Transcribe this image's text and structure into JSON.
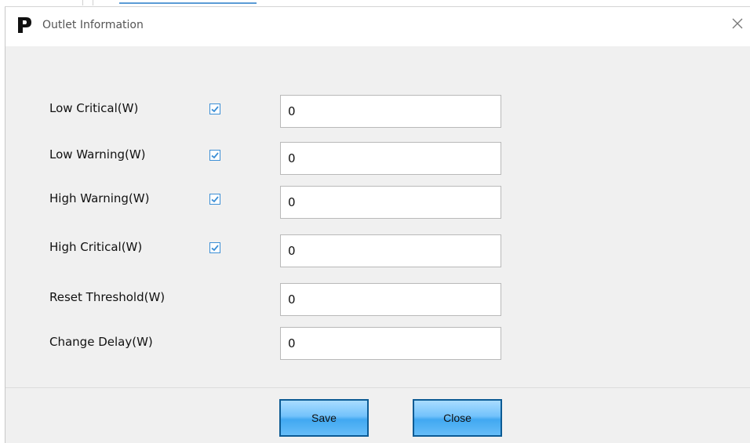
{
  "dialog": {
    "title": "Outlet Information",
    "close_icon": "close-icon",
    "app_icon": "p-logo-icon"
  },
  "fields": [
    {
      "label": "Low Critical(W)",
      "checked": true,
      "value": "0"
    },
    {
      "label": "Low Warning(W)",
      "checked": true,
      "value": "0"
    },
    {
      "label": "High Warning(W)",
      "checked": true,
      "value": "0"
    },
    {
      "label": "High Critical(W)",
      "checked": true,
      "value": "0"
    },
    {
      "label": "Reset Threshold(W)",
      "value": "0"
    },
    {
      "label": "Change Delay(W)",
      "value": "0"
    }
  ],
  "footer": {
    "save_label": "Save",
    "close_label": "Close"
  },
  "colors": {
    "checkbox": "#3c8fd6",
    "button_border": "#0c5b94",
    "button_fill": "#72c2fb"
  }
}
